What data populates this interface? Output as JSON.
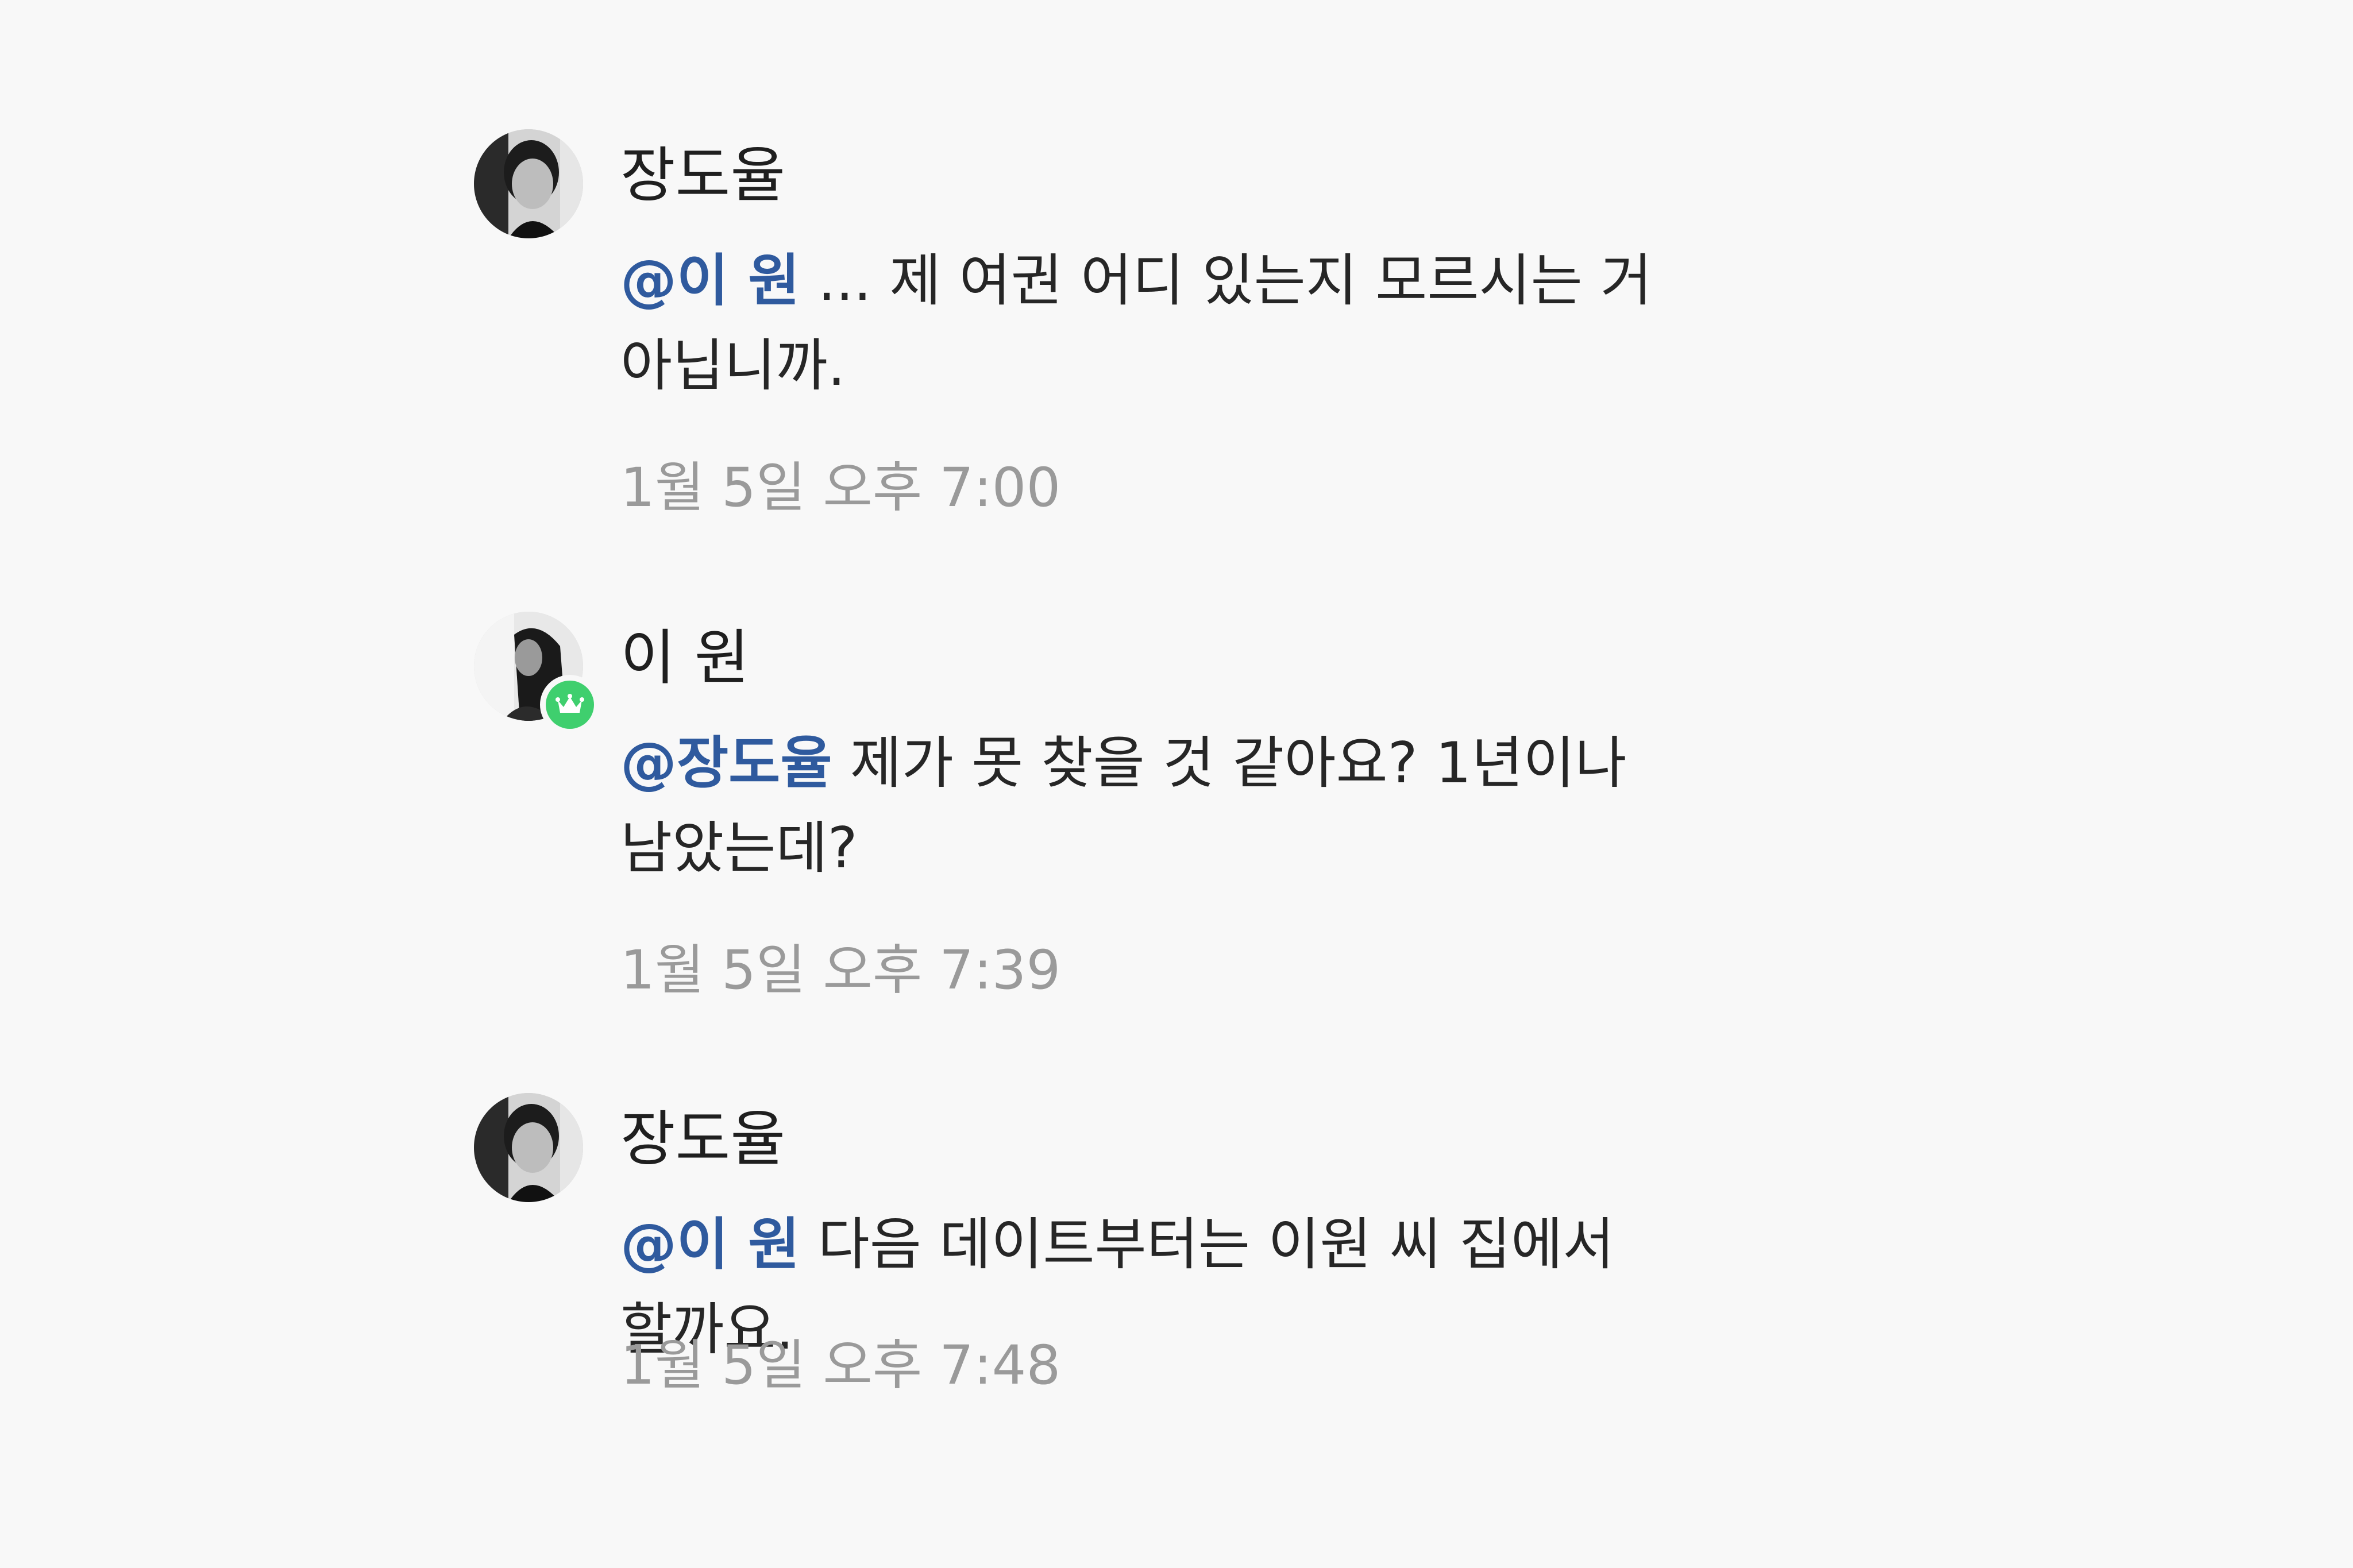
{
  "comments": [
    {
      "author": "장도율",
      "mention": "@이 원",
      "text": " ... 제 여권 어디 있는지 모르시는 거 아닙니까.",
      "timestamp": "1월 5일 오후 7:00",
      "avatar_icon": "profile-photo-man",
      "crown_badge": false
    },
    {
      "author": "이 원",
      "mention": "@장도율",
      "text": " 제가 못 찾을 것 같아요? 1년이나 남았는데?",
      "timestamp": "1월 5일 오후 7:39",
      "avatar_icon": "profile-photo-woman",
      "crown_badge": true,
      "badge_icon": "crown-icon",
      "badge_color": "#3fcf6e"
    },
    {
      "author": "장도율",
      "mention": "@이 원",
      "text": " 다음 데이트부터는 이원 씨 집에서 할까요.",
      "timestamp": "1월 5일 오후 7:48",
      "avatar_icon": "profile-photo-man",
      "crown_badge": false
    }
  ],
  "colors": {
    "background": "#f8f8f8",
    "mention": "#2f5a9e",
    "timestamp": "#9a9a9a"
  }
}
